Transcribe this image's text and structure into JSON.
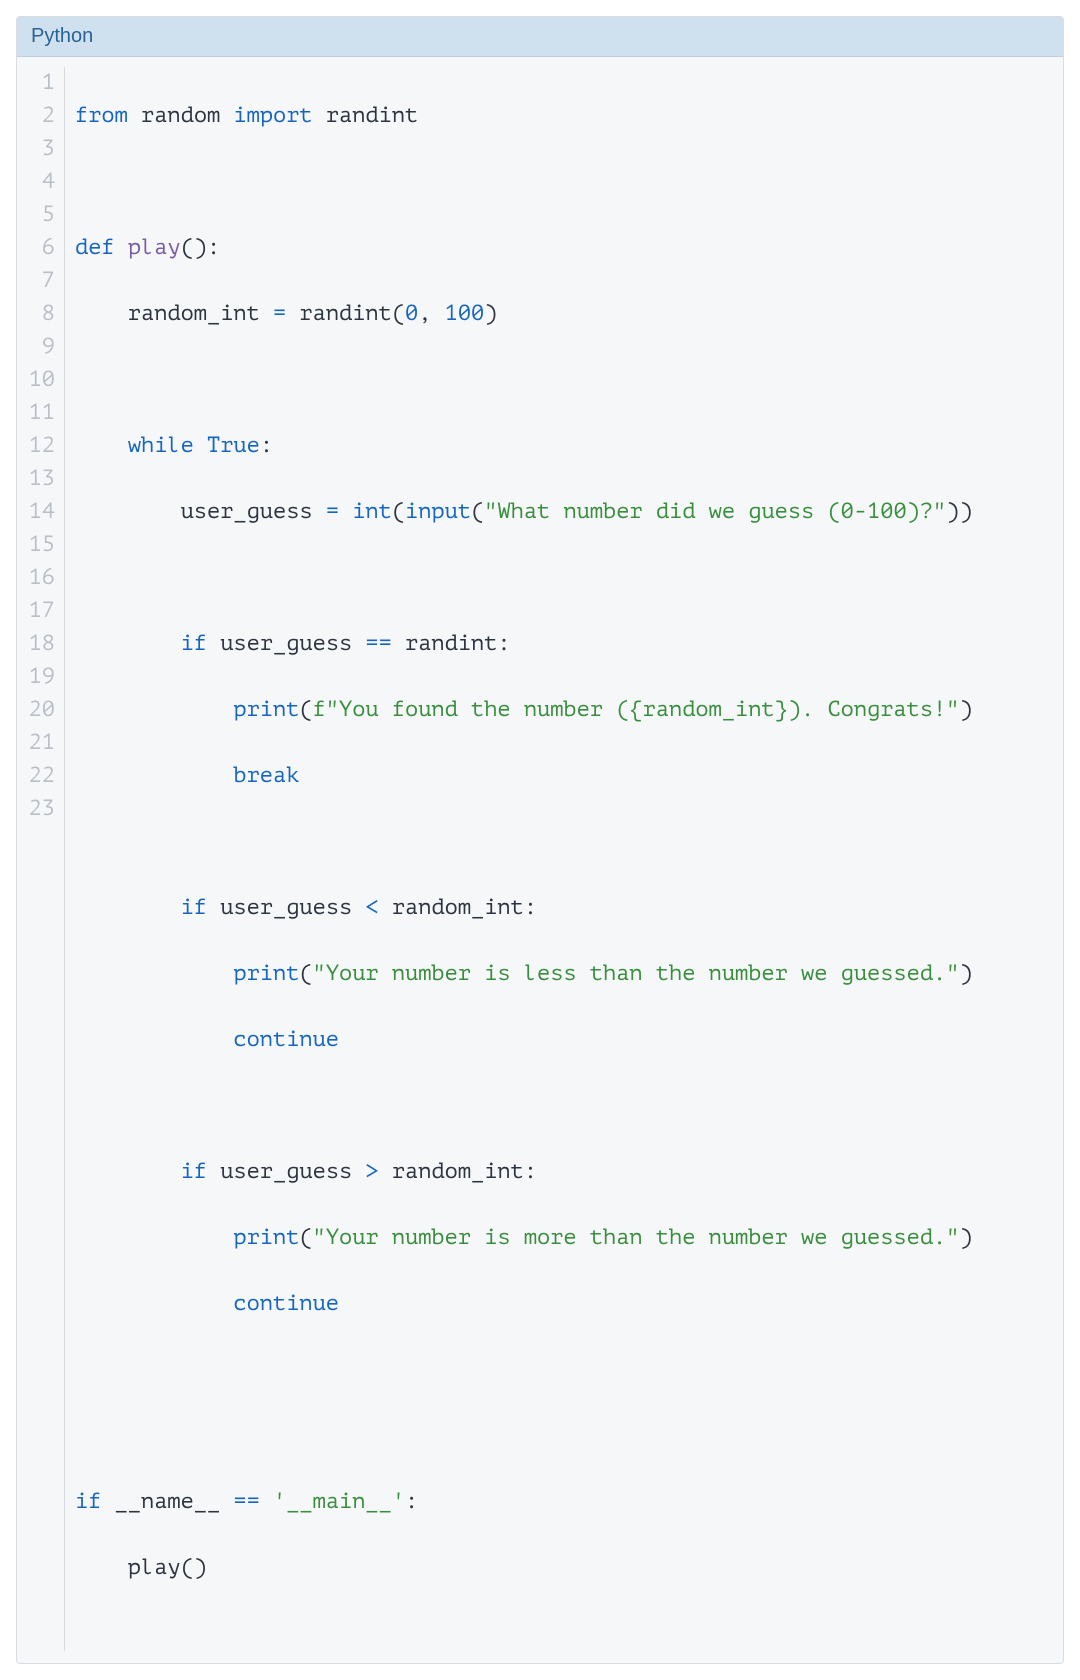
{
  "header": {
    "title": "Python"
  },
  "line_count": 23,
  "code": {
    "l1": {
      "t1": "from",
      "t2": " random ",
      "t3": "import",
      "t4": " randint"
    },
    "l3": {
      "t1": "def",
      "t2": " ",
      "t3": "play",
      "t4": "():"
    },
    "l4": {
      "t1": "    random_int ",
      "t2": "=",
      "t3": " randint(",
      "t4": "0",
      "t5": ", ",
      "t6": "100",
      "t7": ")"
    },
    "l6": {
      "t1": "    ",
      "t2": "while",
      "t3": " ",
      "t4": "True",
      "t5": ":"
    },
    "l7": {
      "t1": "        user_guess ",
      "t2": "=",
      "t3": " ",
      "t4": "int",
      "t5": "(",
      "t6": "input",
      "t7": "(",
      "t8": "\"What number did we guess (0-100)?\"",
      "t9": "))"
    },
    "l9": {
      "t1": "        ",
      "t2": "if",
      "t3": " user_guess ",
      "t4": "==",
      "t5": " randint:"
    },
    "l10": {
      "t1": "            ",
      "t2": "print",
      "t3": "(",
      "t4": "f\"You found the number ({random_int}). Congrats!\"",
      "t5": ")"
    },
    "l11": {
      "t1": "            ",
      "t2": "break"
    },
    "l13": {
      "t1": "        ",
      "t2": "if",
      "t3": " user_guess ",
      "t4": "<",
      "t5": " random_int:"
    },
    "l14": {
      "t1": "            ",
      "t2": "print",
      "t3": "(",
      "t4": "\"Your number is less than the number we guessed.\"",
      "t5": ")"
    },
    "l15": {
      "t1": "            ",
      "t2": "continue"
    },
    "l17": {
      "t1": "        ",
      "t2": "if",
      "t3": " user_guess ",
      "t4": ">",
      "t5": " random_int:"
    },
    "l18": {
      "t1": "            ",
      "t2": "print",
      "t3": "(",
      "t4": "\"Your number is more than the number we guessed.\"",
      "t5": ")"
    },
    "l19": {
      "t1": "            ",
      "t2": "continue"
    },
    "l22": {
      "t1": "if",
      "t2": " __name__ ",
      "t3": "==",
      "t4": " ",
      "t5": "'__main__'",
      "t6": ":"
    },
    "l23": {
      "t1": "    play()"
    }
  }
}
